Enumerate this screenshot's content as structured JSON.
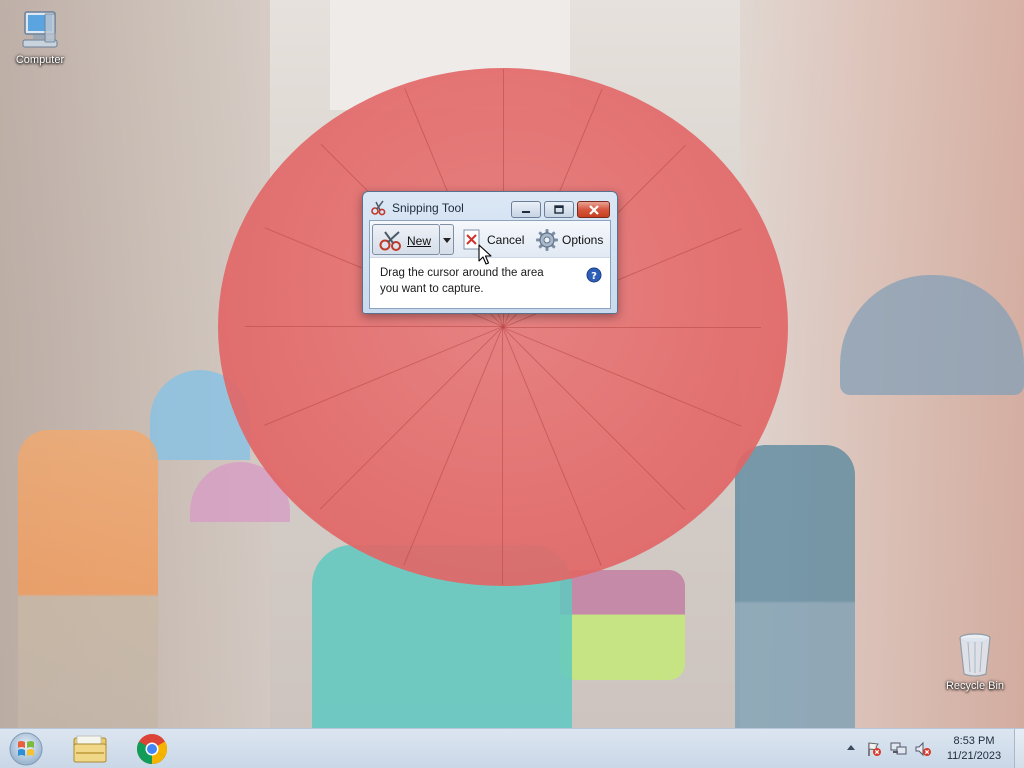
{
  "desktop": {
    "icons": [
      {
        "label": "Computer",
        "icon": "computer-icon"
      },
      {
        "label": "Recycle Bin",
        "icon": "recycle-bin-icon"
      }
    ]
  },
  "snipping_tool": {
    "title": "Snipping Tool",
    "toolbar": {
      "new_label": "New",
      "cancel_label": "Cancel",
      "options_label": "Options"
    },
    "hint_line1": "Drag the cursor around the area",
    "hint_line2": "you want to capture."
  },
  "taskbar": {
    "pinned": [
      "start-orb",
      "windows-explorer",
      "google-chrome"
    ],
    "clock": {
      "time": "8:53 PM",
      "date": "11/21/2023"
    }
  },
  "colors": {
    "window_frame": "#c9daee",
    "close_button": "#c7401f",
    "taskbar": "#c9d7e7"
  }
}
